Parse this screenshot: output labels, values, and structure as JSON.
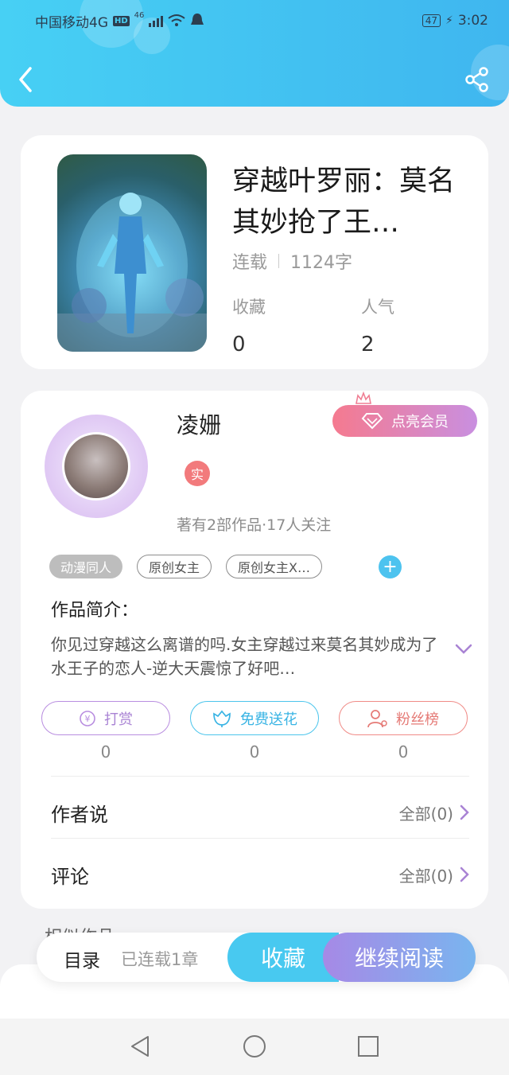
{
  "status_bar": {
    "carrier": "中国移动4G",
    "hd": "HD",
    "network": "46",
    "battery": "47",
    "time": "3:02"
  },
  "book": {
    "title": "穿越叶罗丽：莫名其妙抢了王…",
    "status": "连载",
    "word_count": "1124字",
    "collect_label": "收藏",
    "collect_value": "0",
    "popularity_label": "人气",
    "popularity_value": "2"
  },
  "author": {
    "name": "凌姗",
    "vip_label": "点亮会员",
    "real_badge": "实",
    "stats": "著有2部作品·17人关注"
  },
  "tags": [
    "动漫同人",
    "原创女主",
    "原创女主X…"
  ],
  "intro": {
    "title": "作品简介：",
    "text": "你见过穿越这么离谱的吗.女主穿越过来莫名其妙成为了水王子的恋人-逆大天震惊了好吧…"
  },
  "actions": {
    "reward_label": "打赏",
    "reward_count": "0",
    "flower_label": "免费送花",
    "flower_count": "0",
    "fans_label": "粉丝榜",
    "fans_count": "0"
  },
  "author_says": {
    "title": "作者说",
    "link": "全部(0)"
  },
  "comments": {
    "title": "评论",
    "link": "全部(0)"
  },
  "peek_text": "相似作品",
  "bottom_bar": {
    "catalog": "目录",
    "chapters": "已连载1章",
    "collect": "收藏",
    "continue": "继续阅读"
  },
  "colors": {
    "header_start": "#47d0f4",
    "header_end": "#3fb6ef",
    "accent_blue": "#48c9f0",
    "accent_purple": "#a689e6"
  }
}
